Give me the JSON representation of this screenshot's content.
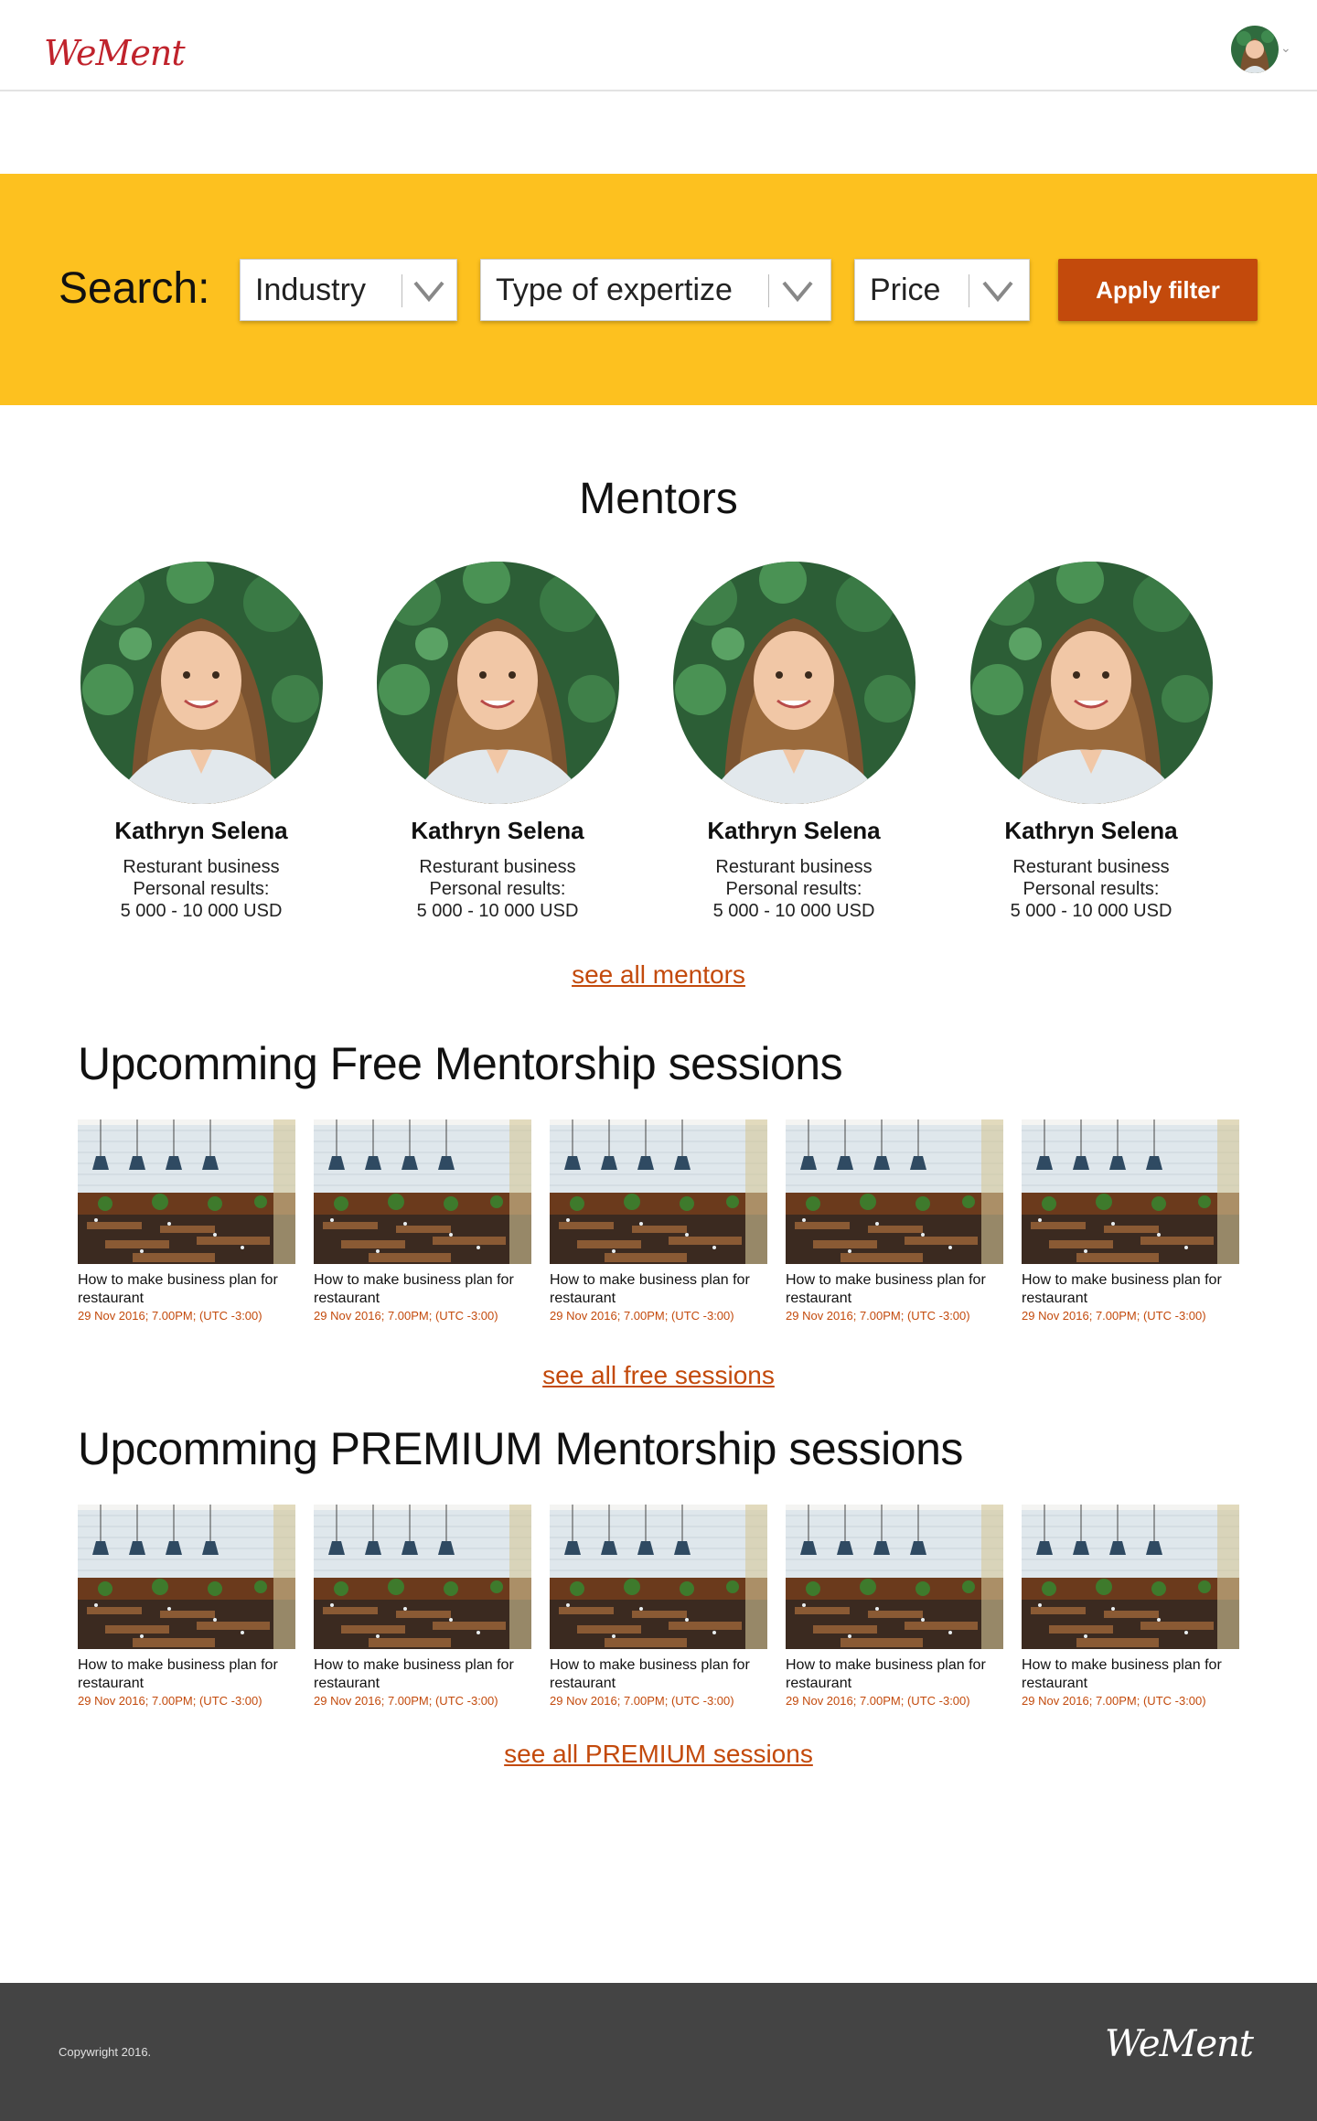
{
  "header": {
    "logo": "WeMent",
    "avatar_icon": "user-avatar-icon"
  },
  "search": {
    "label": "Search:",
    "filters": [
      {
        "label": "Industry"
      },
      {
        "label": "Type of expertize"
      },
      {
        "label": "Price"
      }
    ],
    "apply_label": "Apply filter"
  },
  "mentors": {
    "title": "Mentors",
    "items": [
      {
        "name": "Kathryn Selena",
        "business": "Resturant business",
        "results_label": "Personal results:",
        "results": "5 000 - 10 000 USD"
      },
      {
        "name": "Kathryn Selena",
        "business": "Resturant business",
        "results_label": "Personal results:",
        "results": "5 000 - 10 000 USD"
      },
      {
        "name": "Kathryn Selena",
        "business": "Resturant business",
        "results_label": "Personal results:",
        "results": "5 000 - 10 000 USD"
      },
      {
        "name": "Kathryn Selena",
        "business": "Resturant business",
        "results_label": "Personal results:",
        "results": "5 000 - 10 000 USD"
      }
    ],
    "see_all": "see all mentors"
  },
  "free_sessions": {
    "title": "Upcomming Free Mentorship sessions",
    "items": [
      {
        "title": "How to make business plan for restaurant",
        "date": "29 Nov 2016; 7.00PM; (UTC -3:00)"
      },
      {
        "title": "How to make business plan for restaurant",
        "date": "29 Nov 2016; 7.00PM; (UTC -3:00)"
      },
      {
        "title": "How to make business plan for restaurant",
        "date": "29 Nov 2016; 7.00PM; (UTC -3:00)"
      },
      {
        "title": "How to make business plan for restaurant",
        "date": "29 Nov 2016; 7.00PM; (UTC -3:00)"
      },
      {
        "title": "How to make business plan for restaurant",
        "date": "29 Nov 2016; 7.00PM; (UTC -3:00)"
      }
    ],
    "see_all": "see all free sessions"
  },
  "premium_sessions": {
    "title": "Upcomming PREMIUM Mentorship sessions",
    "items": [
      {
        "title": "How to make business plan for restaurant",
        "date": "29 Nov 2016; 7.00PM; (UTC -3:00)"
      },
      {
        "title": "How to make business plan for restaurant",
        "date": "29 Nov 2016; 7.00PM; (UTC -3:00)"
      },
      {
        "title": "How to make business plan for restaurant",
        "date": "29 Nov 2016; 7.00PM; (UTC -3:00)"
      },
      {
        "title": "How to make business plan for restaurant",
        "date": "29 Nov 2016; 7.00PM; (UTC -3:00)"
      },
      {
        "title": "How to make business plan for restaurant",
        "date": "29 Nov 2016; 7.00PM; (UTC -3:00)"
      }
    ],
    "see_all": "see all PREMIUM sessions"
  },
  "footer": {
    "copyright": "Copywright 2016.",
    "logo": "WeMent"
  },
  "colors": {
    "accent": "#c34a0c",
    "band": "#fdc11f",
    "logo": "#c0232c",
    "footer": "#444444"
  }
}
